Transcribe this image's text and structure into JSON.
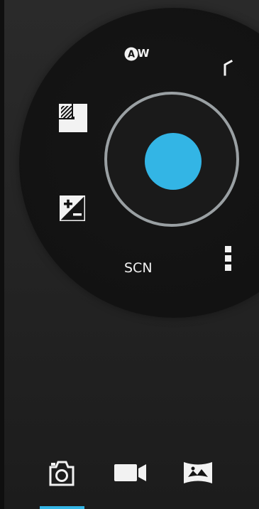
{
  "settings_pie": {
    "white_balance": {
      "badge_letter": "A",
      "suffix": "W",
      "icon": "white-balance-auto-icon"
    },
    "scene_mode": {
      "label": "SCN"
    },
    "flash": {
      "icon": "flash-icon"
    },
    "exposure": {
      "icon": "exposure-plus-minus-icon"
    },
    "metering": {
      "icon": "metering-icon"
    },
    "more": {
      "icon": "more-vertical-icon"
    }
  },
  "shutter": {
    "icon": "shutter-button",
    "color": "#33b5e5",
    "ring_color": "#9aa0a3"
  },
  "modes": {
    "items": [
      {
        "icon": "camera-icon",
        "selected": true
      },
      {
        "icon": "video-camera-icon",
        "selected": false
      },
      {
        "icon": "panorama-icon",
        "selected": false
      }
    ],
    "indicator_color": "#33b5e5"
  }
}
